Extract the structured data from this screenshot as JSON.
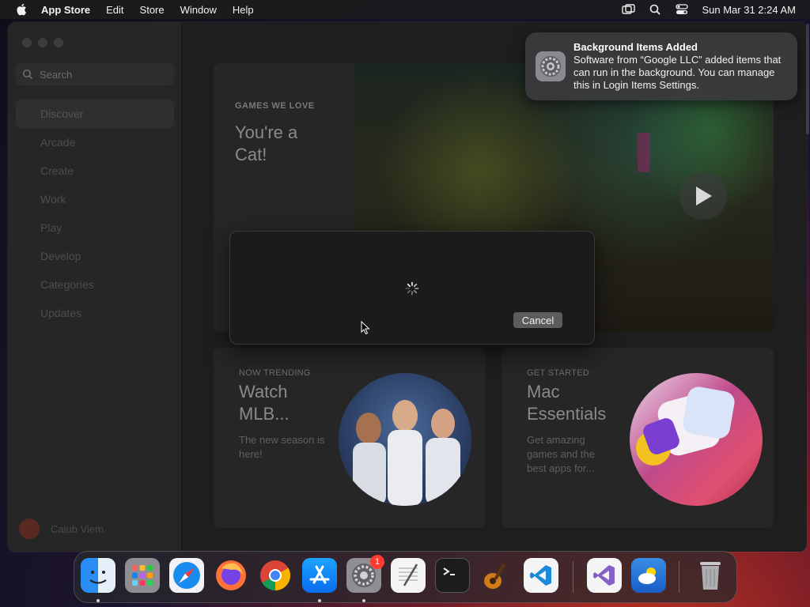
{
  "menubar": {
    "app_name": "App Store",
    "items": [
      "Edit",
      "Store",
      "Window",
      "Help"
    ],
    "clock": "Sun Mar 31  2:24 AM",
    "icons": [
      "apple-icon",
      "screen-mirroring-icon",
      "spotlight-search-icon",
      "control-center-icon"
    ]
  },
  "sidebar": {
    "search_placeholder": "Search",
    "items": [
      {
        "label": "Discover",
        "active": true
      },
      {
        "label": "Arcade"
      },
      {
        "label": "Create"
      },
      {
        "label": "Work"
      },
      {
        "label": "Play"
      },
      {
        "label": "Develop"
      },
      {
        "label": "Categories"
      },
      {
        "label": "Updates"
      }
    ],
    "user_name": "Caiub Viem"
  },
  "hero": {
    "eyebrow": "GAMES WE LOVE",
    "title": "You're a Cat!"
  },
  "cards": [
    {
      "eyebrow": "NOW TRENDING",
      "title": "Watch MLB...",
      "subtitle": "The new season is here!"
    },
    {
      "eyebrow": "GET STARTED",
      "title": "Mac Essentials",
      "subtitle": "Get amazing games and the best apps for..."
    }
  ],
  "dialog": {
    "cancel_label": "Cancel"
  },
  "notification": {
    "title": "Background Items Added",
    "body": "Software from “Google LLC” added items that can run in the background. You can manage this in Login Items Settings."
  },
  "dock": {
    "apps": [
      "Finder",
      "Launchpad",
      "Safari",
      "Firefox",
      "Chrome",
      "App Store",
      "System Settings",
      "TextEdit",
      "Terminal",
      "GarageBand",
      "Visual Studio Code",
      "Visual Studio",
      "Weather",
      "Trash"
    ],
    "system_settings_badge": "1"
  },
  "colors": {
    "accent_blue": "#0a84ff",
    "badge_red": "#ff3b30"
  }
}
